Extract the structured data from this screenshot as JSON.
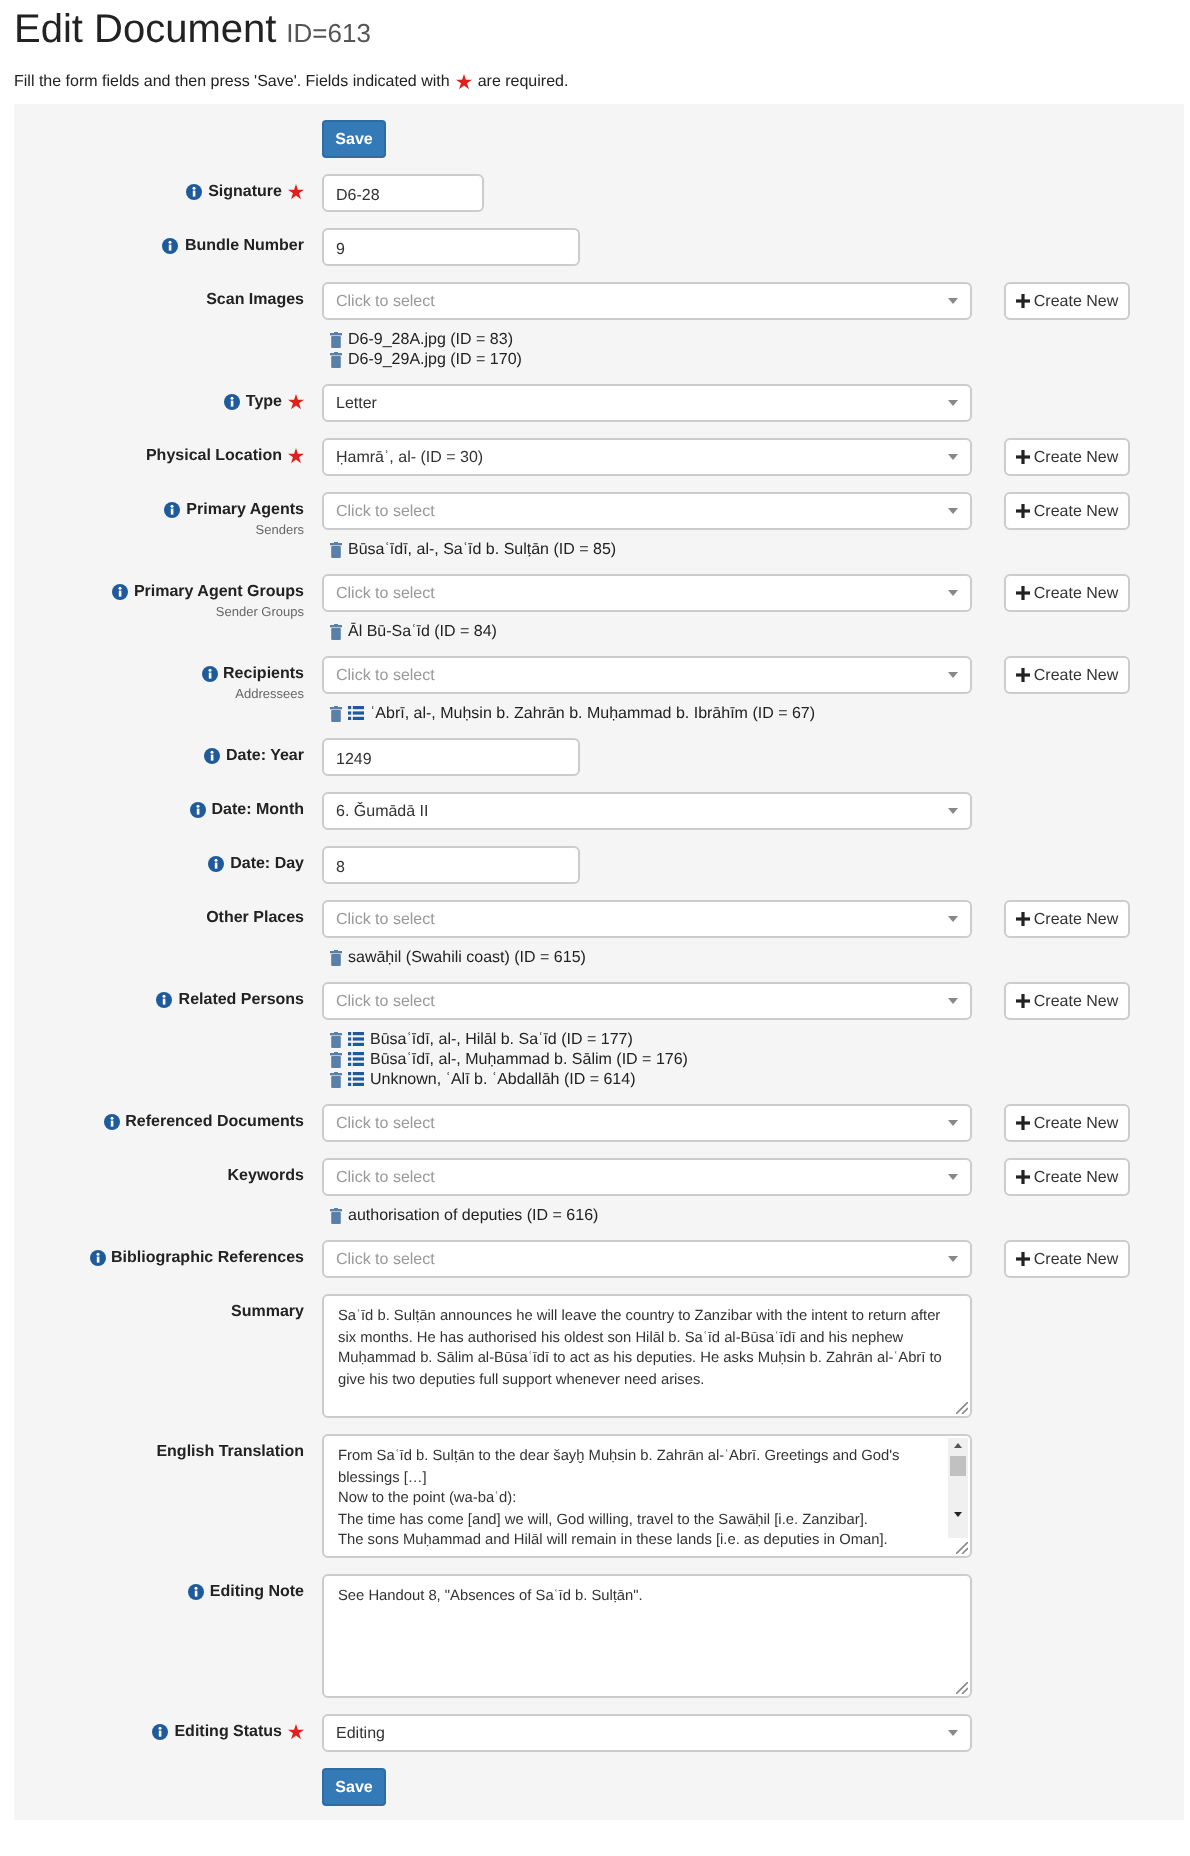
{
  "title": "Edit Document",
  "id_label": "ID=613",
  "instructions": {
    "before": "Fill the form fields and then press 'Save'. Fields indicated with",
    "after": "are required."
  },
  "fields": [
    {
      "kind": "button",
      "label": "Save"
    },
    {
      "kind": "short-text",
      "label": "Signature",
      "info": true,
      "required": true,
      "value": "D6-28"
    },
    {
      "kind": "text",
      "label": "Bundle Number",
      "info": true,
      "required": false,
      "value": "9"
    },
    {
      "kind": "select",
      "label": "Scan Images",
      "info": false,
      "required": false,
      "placeholder": "Click to select",
      "create": "Create New",
      "items": [
        {
          "text": "D6-9_28A.jpg (ID = 83)",
          "list_icon": false
        },
        {
          "text": "D6-9_29A.jpg (ID = 170)",
          "list_icon": false
        }
      ]
    },
    {
      "kind": "select",
      "label": "Type",
      "info": true,
      "required": true,
      "value": "Letter"
    },
    {
      "kind": "select",
      "label": "Physical Location",
      "info": false,
      "required": true,
      "value": "Ḥamrāʾ, al- (ID = 30)",
      "create": "Create New"
    },
    {
      "kind": "select",
      "label": "Primary Agents",
      "sublabel": "Senders",
      "info": true,
      "required": false,
      "placeholder": "Click to select",
      "create": "Create New",
      "items": [
        {
          "text": "Būsaʿīdī, al-, Saʿīd b. Sulṭān (ID = 85)",
          "list_icon": false
        }
      ]
    },
    {
      "kind": "select",
      "label": "Primary Agent Groups",
      "sublabel": "Sender Groups",
      "info": true,
      "required": false,
      "placeholder": "Click to select",
      "create": "Create New",
      "items": [
        {
          "text": "Āl Bū-Saʿīd (ID = 84)",
          "list_icon": false
        }
      ]
    },
    {
      "kind": "select",
      "label": "Recipients",
      "sublabel": "Addressees",
      "info": true,
      "required": false,
      "placeholder": "Click to select",
      "create": "Create New",
      "items": [
        {
          "text": "ʿAbrī, al-, Muḥsin b. Zahrān b. Muḥammad b. Ibrāhīm (ID = 67)",
          "list_icon": true
        }
      ]
    },
    {
      "kind": "text",
      "label": "Date: Year",
      "info": true,
      "required": false,
      "value": "1249"
    },
    {
      "kind": "select",
      "label": "Date: Month",
      "info": true,
      "required": false,
      "value": "6. Ǧumādā II"
    },
    {
      "kind": "text",
      "label": "Date: Day",
      "info": true,
      "required": false,
      "value": "8"
    },
    {
      "kind": "select",
      "label": "Other Places",
      "info": false,
      "required": false,
      "placeholder": "Click to select",
      "create": "Create New",
      "items": [
        {
          "text": "sawāḥil (Swahili coast) (ID = 615)",
          "list_icon": false
        }
      ]
    },
    {
      "kind": "select",
      "label": "Related Persons",
      "info": true,
      "required": false,
      "placeholder": "Click to select",
      "create": "Create New",
      "items": [
        {
          "text": "Būsaʿīdī, al-, Hilāl b. Saʿīd (ID = 177)",
          "list_icon": true
        },
        {
          "text": "Būsaʿīdī, al-, Muḥammad b. Sālim (ID = 176)",
          "list_icon": true
        },
        {
          "text": "Unknown, ʿAlī b. ʿAbdallāh (ID = 614)",
          "list_icon": true
        }
      ]
    },
    {
      "kind": "select",
      "label": "Referenced Documents",
      "info": true,
      "required": false,
      "placeholder": "Click to select",
      "create": "Create New"
    },
    {
      "kind": "select",
      "label": "Keywords",
      "info": false,
      "required": false,
      "placeholder": "Click to select",
      "create": "Create New",
      "items": [
        {
          "text": "authorisation of deputies (ID = 616)",
          "list_icon": false
        }
      ]
    },
    {
      "kind": "select",
      "label": "Bibliographic References",
      "info": true,
      "required": false,
      "placeholder": "Click to select",
      "create": "Create New"
    },
    {
      "kind": "textarea",
      "label": "Summary",
      "info": false,
      "required": false,
      "scrollbar": false,
      "value": "Saʿīd b. Sulṭān announces he will leave the country to Zanzibar with the intent to return after six months. He has authorised his oldest son Hilāl b. Saʿīd al-Būsaʿīdī and his nephew Muḥammad b. Sālim al-Būsaʿīdī to act as his deputies. He asks Muḥsin b. Zahrān al-ʿAbrī to give his two deputies full support whenever need arises."
    },
    {
      "kind": "textarea",
      "label": "English Translation",
      "info": false,
      "required": false,
      "scrollbar": true,
      "value": "From Saʿīd b. Sulṭān to the dear šayḫ Muḥsin b. Zahrān al-ʿAbrī. Greetings and God's blessings […]\nNow to the point (wa-baʿd):\nThe time has come [and] we will, God willing, travel to the Sawāḥil [i.e. Zanzibar].\nThe sons Muḥammad and Hilāl will remain in these lands [i.e. as deputies in Oman]."
    },
    {
      "kind": "textarea",
      "label": "Editing Note",
      "info": true,
      "required": false,
      "scrollbar": false,
      "value": "See Handout 8, \"Absences of Saʿīd b. Sulṭān\"."
    },
    {
      "kind": "select",
      "label": "Editing Status",
      "info": true,
      "required": true,
      "value": "Editing"
    },
    {
      "kind": "button",
      "label": "Save"
    }
  ]
}
